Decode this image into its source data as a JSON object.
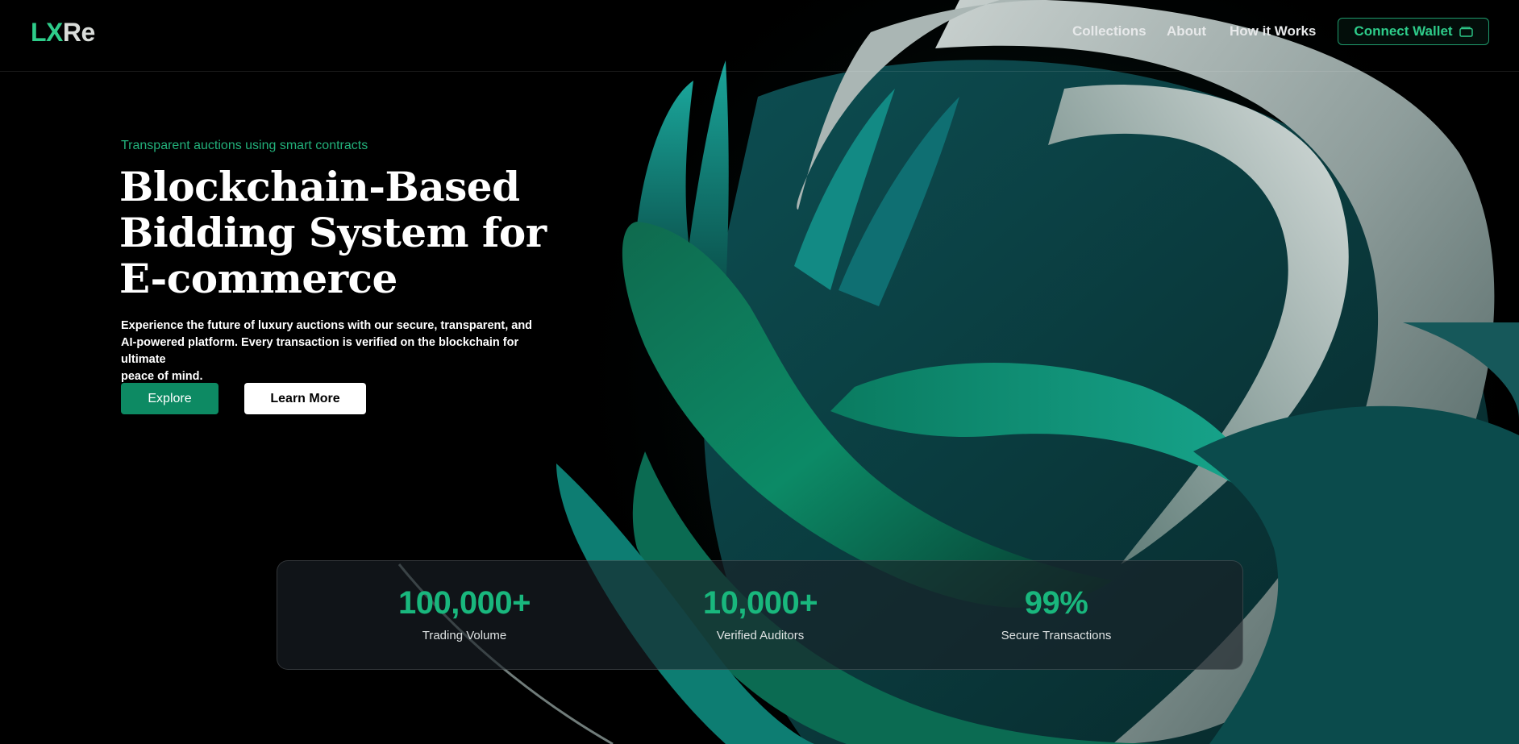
{
  "header": {
    "logo": {
      "part1": "LX",
      "part2": "Re"
    },
    "nav": [
      {
        "label": "Collections"
      },
      {
        "label": "About"
      },
      {
        "label": "How it Works"
      }
    ],
    "wallet_button": {
      "label": "Connect Wallet",
      "icon": "wallet-icon"
    }
  },
  "hero": {
    "eyebrow": "Transparent auctions using smart contracts",
    "title_lines": [
      "Blockchain-Based",
      "Bidding System for",
      "E-commerce"
    ],
    "description_lines": [
      "Experience the future of luxury auctions with our secure, transparent, and",
      "AI-powered platform. Every transaction is verified on the blockchain for ultimate",
      "peace of mind."
    ],
    "explore_label": "Explore",
    "learn_more_label": "Learn More"
  },
  "stats": [
    {
      "value": "100,000+",
      "label": "Trading Volume"
    },
    {
      "value": "10,000+",
      "label": "Verified Auditors"
    },
    {
      "value": "99%",
      "label": "Secure Transactions"
    }
  ],
  "colors": {
    "background": "#000000",
    "accent": "#19b77d",
    "explore_button": "#0d8a63",
    "stats_panel": "#1a2026"
  }
}
